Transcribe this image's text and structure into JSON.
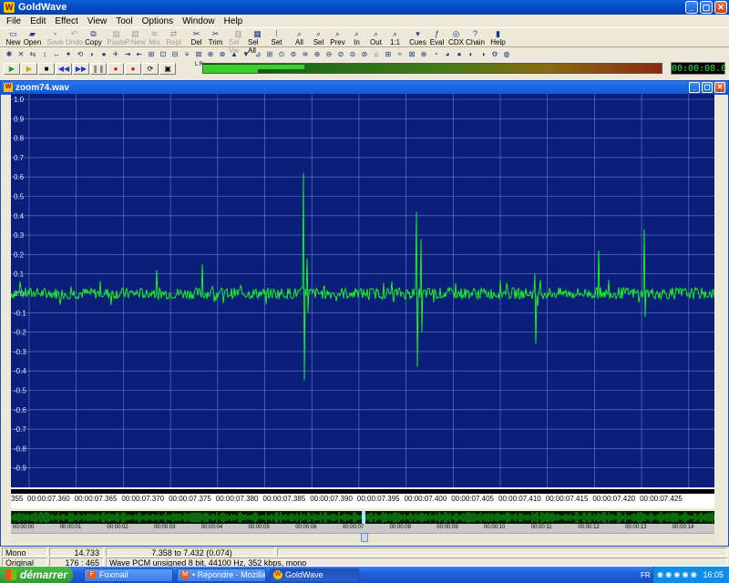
{
  "window": {
    "title": "GoldWave"
  },
  "menu": [
    "File",
    "Edit",
    "Effect",
    "View",
    "Tool",
    "Options",
    "Window",
    "Help"
  ],
  "toolbar_main": [
    {
      "label": "New",
      "icon": "new-file-icon",
      "enabled": true
    },
    {
      "label": "Open",
      "icon": "open-folder-icon",
      "enabled": true
    },
    {
      "label": "Save",
      "icon": "save-disk-icon",
      "enabled": false
    },
    {
      "label": "Undo",
      "icon": "undo-arrow-icon",
      "enabled": false
    },
    {
      "label": "Copy",
      "icon": "copy-icon",
      "enabled": true
    },
    {
      "label": "Paste",
      "icon": "paste-icon",
      "enabled": false
    },
    {
      "label": "P.New",
      "icon": "paste-new-icon",
      "enabled": false
    },
    {
      "label": "Mix",
      "icon": "mix-icon",
      "enabled": false
    },
    {
      "label": "Repl",
      "icon": "replace-icon",
      "enabled": false
    },
    {
      "label": "Del",
      "icon": "delete-icon",
      "enabled": true
    },
    {
      "label": "Trim",
      "icon": "trim-icon",
      "enabled": true
    },
    {
      "label": "Sel Vw",
      "icon": "select-view-icon",
      "enabled": false
    },
    {
      "label": "Sel All",
      "icon": "select-all-icon",
      "enabled": true
    },
    {
      "label": "Set",
      "icon": "set-marker-icon",
      "enabled": true
    },
    {
      "label": "All",
      "icon": "zoom-all-icon",
      "enabled": true
    },
    {
      "label": "Sel",
      "icon": "zoom-selection-icon",
      "enabled": true
    },
    {
      "label": "Prev",
      "icon": "zoom-previous-icon",
      "enabled": true
    },
    {
      "label": "In",
      "icon": "zoom-in-icon",
      "enabled": true
    },
    {
      "label": "Out",
      "icon": "zoom-out-icon",
      "enabled": true
    },
    {
      "label": "1:1",
      "icon": "zoom-1to1-icon",
      "enabled": true
    },
    {
      "label": "Cues",
      "icon": "cues-icon",
      "enabled": true
    },
    {
      "label": "Eval",
      "icon": "eval-icon",
      "enabled": true
    },
    {
      "label": "CDX",
      "icon": "cdx-icon",
      "enabled": true
    },
    {
      "label": "Chain",
      "icon": "chain-icon",
      "enabled": true
    },
    {
      "label": "Help",
      "icon": "help-book-icon",
      "enabled": true
    }
  ],
  "transport": {
    "buttons": [
      "play-icon",
      "play-selection-icon",
      "stop-icon",
      "rewind-icon",
      "fast-forward-icon",
      "pause-icon",
      "record-icon",
      "record-selection-icon",
      "loop-icon",
      "settings-icon"
    ],
    "meter_channels": "L R",
    "time_display": "00:00:08.0"
  },
  "meter_level": {
    "left": 0.22,
    "right": 0.12
  },
  "document": {
    "title": "zoom74.wav",
    "y_ticks": [
      "1.0",
      "0.9",
      "0.8",
      "0.7",
      "0.6",
      "0.5",
      "0.4",
      "0.3",
      "0.2",
      "0.1",
      "0.0",
      "-0.1",
      "-0.2",
      "-0.3",
      "-0.4",
      "-0.5",
      "-0.6",
      "-0.7",
      "-0.8",
      "-0.9"
    ],
    "time_ticks": [
      "355",
      "00:00:07.360",
      "00:00:07.365",
      "00:00:07.370",
      "00:00:07.375",
      "00:00:07.380",
      "00:00:07.385",
      "00:00:07.390",
      "00:00:07.395",
      "00:00:07.400",
      "00:00:07.405",
      "00:00:07.410",
      "00:00:07.415",
      "00:00:07.420",
      "00:00:07.425"
    ],
    "overview_ticks": [
      "00:00:00",
      "00:00:01",
      "00:00:02",
      "00:00:03",
      "00:00:04",
      "00:00:05",
      "00:00:06",
      "00:00:07",
      "00:00:08",
      "00:00:09",
      "00:00:10",
      "00:00:11",
      "00:00:12",
      "00:00:13",
      "00:00:14"
    ],
    "colors": {
      "background": "#0a1f7a",
      "grid": "#6a7fd0",
      "wave": "#1aff1a",
      "axis_text": "#e0e0ff"
    }
  },
  "status": {
    "channel": "Mono",
    "length": "14.733",
    "selection": "7.358 to 7.432 (0.074)",
    "original_label": "Original",
    "original_value": "176 : 465",
    "format": "Wave PCM unsigned 8 bit, 44100 Hz, 352 kbps, mono"
  },
  "taskbar": {
    "start": "démarrer",
    "tasks": [
      {
        "label": "Foxmail",
        "icon": "foxmail-icon",
        "active": false
      },
      {
        "label": "• Répondre - Mozilla ...",
        "icon": "firefox-icon",
        "active": false
      },
      {
        "label": "GoldWave",
        "icon": "goldwave-icon",
        "active": true
      }
    ],
    "lang": "FR",
    "clock": "16:05"
  }
}
